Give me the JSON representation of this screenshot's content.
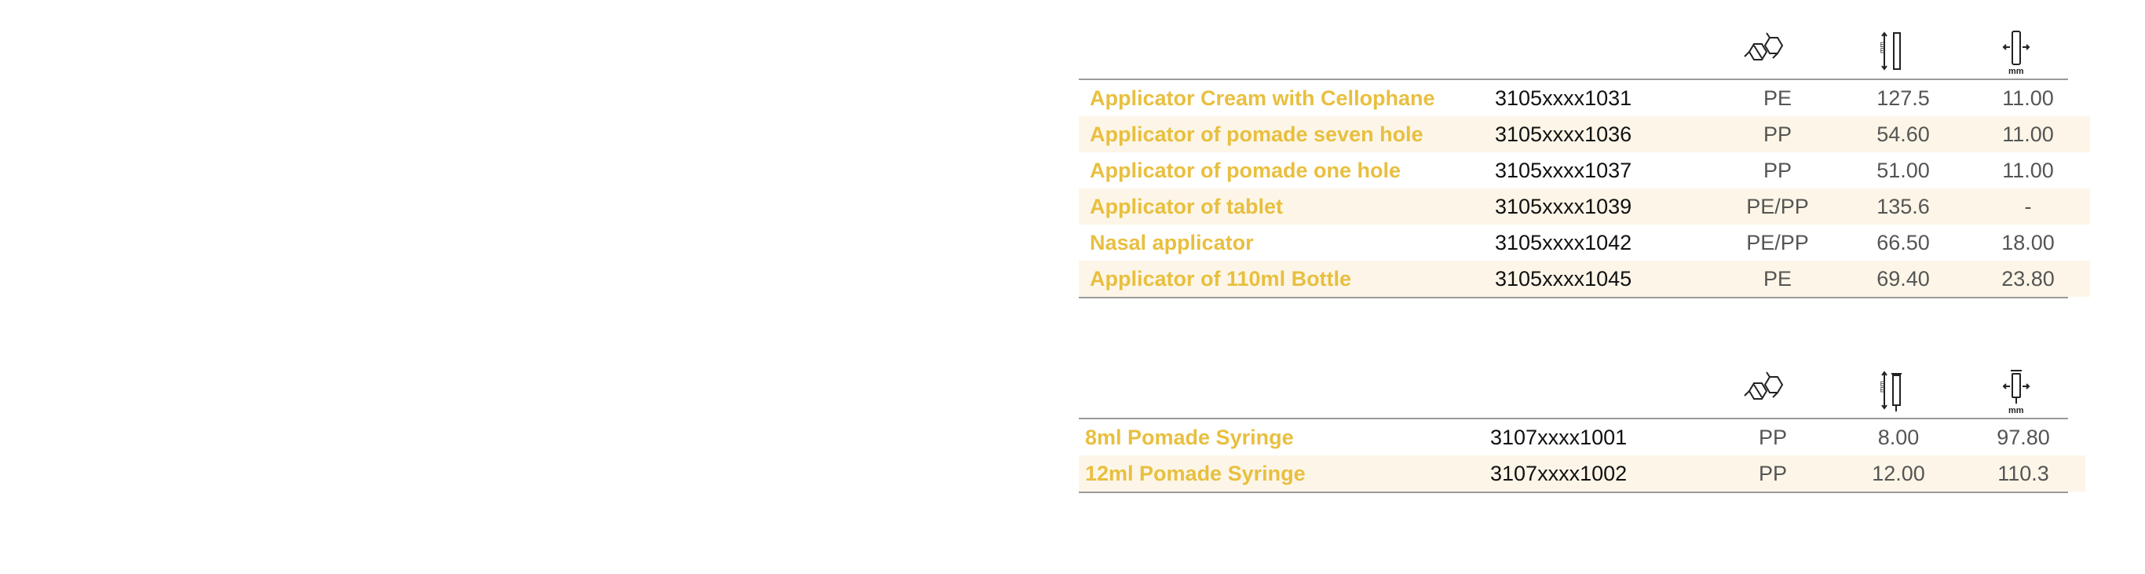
{
  "tables": [
    {
      "header_icons": [
        "polymer-icon",
        "length-icon",
        "diameter-icon"
      ],
      "rows": [
        {
          "name": "Applicator Cream with Cellophane",
          "code": "3105xxxx1031",
          "material": "PE",
          "length": "127.5",
          "diameter": "11.00"
        },
        {
          "name": "Applicator of pomade seven hole",
          "code": "3105xxxx1036",
          "material": "PP",
          "length": "54.60",
          "diameter": "11.00"
        },
        {
          "name": "Applicator of pomade one hole",
          "code": "3105xxxx1037",
          "material": "PP",
          "length": "51.00",
          "diameter": "11.00"
        },
        {
          "name": "Applicator of tablet",
          "code": "3105xxxx1039",
          "material": "PE/PP",
          "length": "135.6",
          "diameter": "-"
        },
        {
          "name": "Nasal applicator",
          "code": "3105xxxx1042",
          "material": "PE/PP",
          "length": "66.50",
          "diameter": "18.00"
        },
        {
          "name": "Applicator of 110ml Bottle",
          "code": "3105xxxx1045",
          "material": "PE",
          "length": "69.40",
          "diameter": "23.80"
        }
      ]
    },
    {
      "header_icons": [
        "polymer-icon",
        "syringe-length-icon",
        "syringe-diameter-icon"
      ],
      "rows": [
        {
          "name": "8ml Pomade Syringe",
          "code": "3107xxxx1001",
          "material": "PP",
          "length": "8.00",
          "diameter": "97.80"
        },
        {
          "name": "12ml Pomade Syringe",
          "code": "3107xxxx1002",
          "material": "PP",
          "length": "12.00",
          "diameter": "110.3"
        }
      ]
    }
  ],
  "icon_labels": {
    "unit": "mm"
  },
  "colors": {
    "name_text": "#e8bf3f",
    "row_shade": "#fdf6e8",
    "rule": "#9a9a9a",
    "code_text": "#111111",
    "value_text": "#555555"
  }
}
